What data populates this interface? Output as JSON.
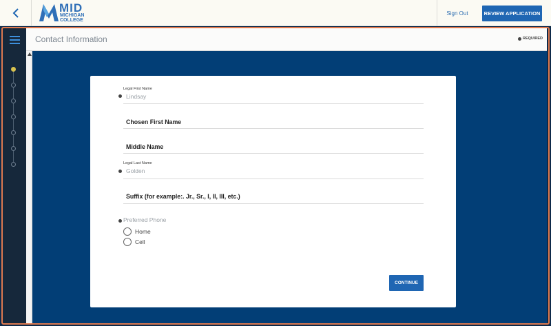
{
  "topbar": {
    "logo": {
      "main": "MID",
      "sub_line1": "MICHIGAN",
      "sub_line2": "COLLEGE"
    },
    "sign_out": "Sign Out",
    "review_button": "REVIEW APPLICATION"
  },
  "header": {
    "title": "Contact Information",
    "required_note": "REQUIRED"
  },
  "sidebar": {
    "steps": [
      {
        "state": "current"
      },
      {
        "state": "pending"
      },
      {
        "state": "pending"
      },
      {
        "state": "pending"
      },
      {
        "state": "pending"
      },
      {
        "state": "pending"
      },
      {
        "state": "pending"
      }
    ]
  },
  "form": {
    "legal_first_name": {
      "label": "Legal First Name",
      "value": "Lindsay",
      "required": true
    },
    "chosen_first_name": {
      "label": "Chosen First Name"
    },
    "middle_name": {
      "label": "Middle Name"
    },
    "legal_last_name": {
      "label": "Legal Last Name",
      "value": "Golden",
      "required": true
    },
    "suffix": {
      "label": "Suffix (for example:. Jr., Sr., I, II, III, etc.)"
    },
    "preferred_phone": {
      "label": "Preferred Phone",
      "required": true,
      "options": [
        "Home",
        "Cell"
      ]
    },
    "continue_button": "CONTINUE"
  },
  "colors": {
    "brand_blue": "#1f66b3",
    "main_bg": "#023e76",
    "frame_orange": "#e07a4e",
    "current_step": "#d8c24f"
  }
}
